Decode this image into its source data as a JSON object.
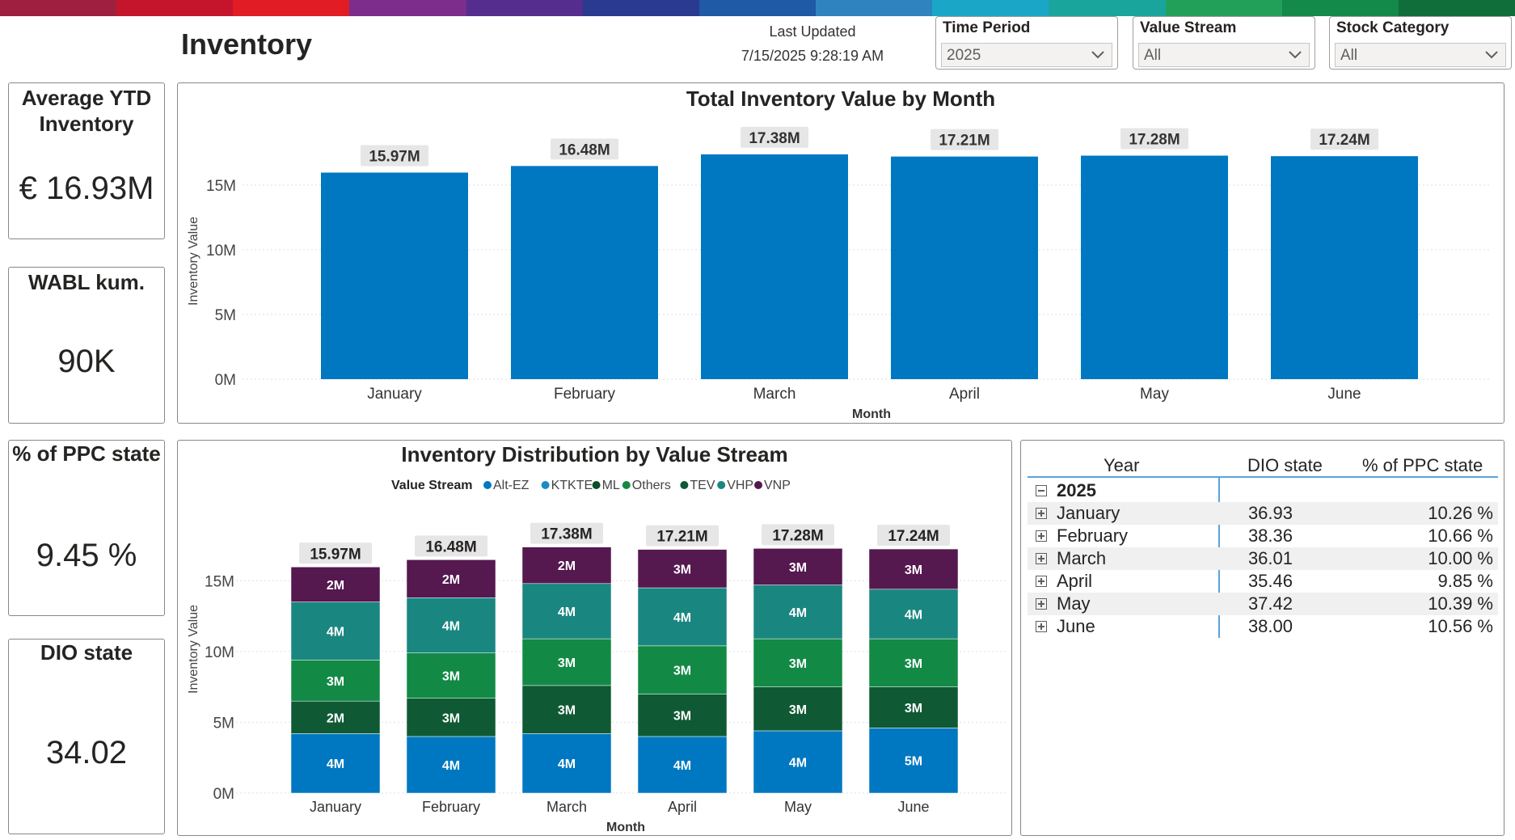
{
  "colors": {
    "accent_bar": [
      "#9e1f3f",
      "#c4152d",
      "#e11c24",
      "#7b2e8c",
      "#552d8f",
      "#2a3a8f",
      "#1e5aa6",
      "#2f84c0",
      "#1aa6c7",
      "#19a59c",
      "#22a05a",
      "#148a4a",
      "#0f6e3a"
    ],
    "bar_blue": "#0078c1",
    "series": {
      "Alt-EZ": "#0078c1",
      "KTKTE": "#1b8ac9",
      "ML": "#0b4f2a",
      "Others": "#128a45",
      "TEV": "#0f5a34",
      "VHP": "#1a8680",
      "VNP": "#55184f"
    }
  },
  "header": {
    "title": "Inventory",
    "last_updated_label": "Last Updated",
    "last_updated_value": "7/15/2025 9:28:19 AM"
  },
  "slicers": [
    {
      "title": "Time Period",
      "value": "2025"
    },
    {
      "title": "Value Stream",
      "value": "All"
    },
    {
      "title": "Stock Category",
      "value": "All"
    }
  ],
  "kpis": [
    {
      "title": "Average YTD Inventory",
      "value": "€ 16.93M"
    },
    {
      "title": "WABL kum.",
      "value": "90K"
    },
    {
      "title": "% of PPC state",
      "value": "9.45 %"
    },
    {
      "title": "DIO state",
      "value": "34.02"
    }
  ],
  "chart_data": [
    {
      "type": "bar",
      "title": "Total Inventory Value by Month",
      "xlabel": "Month",
      "ylabel": "Inventory Value",
      "categories": [
        "January",
        "February",
        "March",
        "April",
        "May",
        "June"
      ],
      "values": [
        15.97,
        16.48,
        17.38,
        17.21,
        17.28,
        17.24
      ],
      "data_labels": [
        "15.97M",
        "16.48M",
        "17.38M",
        "17.21M",
        "17.28M",
        "17.24M"
      ],
      "y_ticks": [
        "0M",
        "5M",
        "10M",
        "15M"
      ],
      "ylim": [
        0,
        18.5
      ],
      "unit": "M"
    },
    {
      "type": "bar",
      "stacked": true,
      "title": "Inventory Distribution by Value Stream",
      "xlabel": "Month",
      "ylabel": "Inventory Value",
      "legend_title": "Value Stream",
      "legend_position": "top",
      "categories": [
        "January",
        "February",
        "March",
        "April",
        "May",
        "June"
      ],
      "totals": [
        "15.97M",
        "16.48M",
        "17.38M",
        "17.21M",
        "17.28M",
        "17.24M"
      ],
      "total_values": [
        15.97,
        16.48,
        17.38,
        17.21,
        17.28,
        17.24
      ],
      "y_ticks": [
        "0M",
        "5M",
        "10M",
        "15M"
      ],
      "ylim": [
        0,
        18.5
      ],
      "series": [
        {
          "name": "Alt-EZ",
          "values": [
            4.2,
            4.0,
            4.2,
            4.0,
            4.4,
            4.6
          ],
          "labels": [
            "4M",
            "4M",
            "4M",
            "4M",
            "4M",
            "5M"
          ]
        },
        {
          "name": "KTKTE",
          "values": [
            0,
            0,
            0,
            0,
            0,
            0
          ],
          "labels": [
            "",
            "",
            "",
            "",
            "",
            ""
          ]
        },
        {
          "name": "ML",
          "values": [
            0,
            0,
            0,
            0,
            0,
            0
          ],
          "labels": [
            "",
            "",
            "",
            "",
            "",
            ""
          ]
        },
        {
          "name": "TEV",
          "values": [
            2.3,
            2.7,
            3.4,
            3.0,
            3.1,
            2.9
          ],
          "labels": [
            "2M",
            "3M",
            "3M",
            "3M",
            "3M",
            "3M"
          ]
        },
        {
          "name": "Others",
          "values": [
            2.9,
            3.2,
            3.3,
            3.4,
            3.4,
            3.4
          ],
          "labels": [
            "3M",
            "3M",
            "3M",
            "3M",
            "3M",
            "3M"
          ]
        },
        {
          "name": "VHP",
          "values": [
            4.1,
            3.9,
            3.9,
            4.1,
            3.8,
            3.5
          ],
          "labels": [
            "4M",
            "4M",
            "4M",
            "4M",
            "4M",
            "4M"
          ]
        },
        {
          "name": "VNP",
          "values": [
            2.47,
            2.68,
            2.58,
            2.71,
            2.58,
            2.84
          ],
          "labels": [
            "2M",
            "2M",
            "2M",
            "3M",
            "3M",
            "3M"
          ]
        }
      ],
      "legend": [
        "Alt-EZ",
        "KTKTE",
        "ML",
        "Others",
        "TEV",
        "VHP",
        "VNP"
      ]
    }
  ],
  "matrix": {
    "headers": [
      "Year",
      "DIO state",
      "% of PPC state"
    ],
    "year": "2025",
    "rows": [
      {
        "month": "January",
        "dio": "36.93",
        "ppc": "10.26 %"
      },
      {
        "month": "February",
        "dio": "38.36",
        "ppc": "10.66 %"
      },
      {
        "month": "March",
        "dio": "36.01",
        "ppc": "10.00 %"
      },
      {
        "month": "April",
        "dio": "35.46",
        "ppc": "9.85 %"
      },
      {
        "month": "May",
        "dio": "37.42",
        "ppc": "10.39 %"
      },
      {
        "month": "June",
        "dio": "38.00",
        "ppc": "10.56 %"
      }
    ]
  }
}
